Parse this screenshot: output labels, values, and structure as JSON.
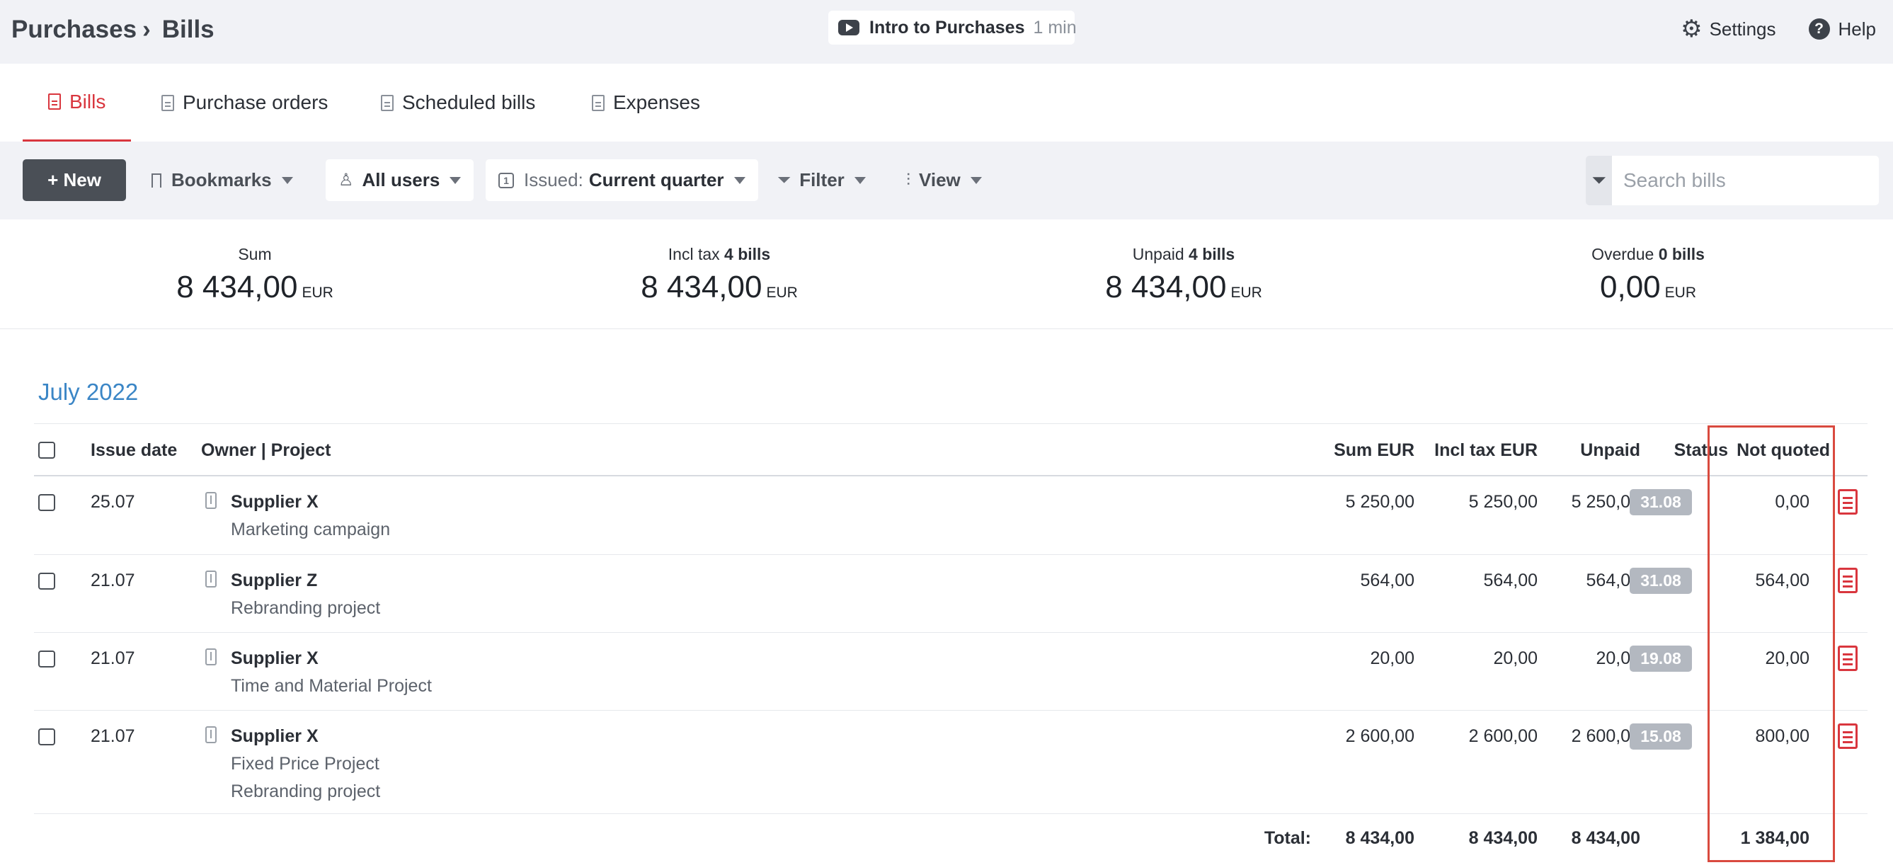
{
  "header": {
    "breadcrumb_parent": "Purchases",
    "breadcrumb_sep": "›",
    "breadcrumb_current": "Bills",
    "intro_label": "Intro to Purchases",
    "intro_duration": "1 min",
    "settings_label": "Settings",
    "help_label": "Help"
  },
  "tabs": [
    {
      "label": "Bills",
      "active": true
    },
    {
      "label": "Purchase orders",
      "active": false
    },
    {
      "label": "Scheduled bills",
      "active": false
    },
    {
      "label": "Expenses",
      "active": false
    }
  ],
  "toolbar": {
    "new_label": "+ New",
    "bookmarks_label": "Bookmarks",
    "users_label": "All users",
    "issued_prefix": "Issued:",
    "issued_value": "Current quarter",
    "calendar_number": "1",
    "filter_label": "Filter",
    "view_label": "View",
    "search_placeholder": "Search bills"
  },
  "summary": [
    {
      "label": "Sum",
      "bold": "",
      "value": "8 434,00",
      "currency": "EUR"
    },
    {
      "label": "Incl tax",
      "bold": "4 bills",
      "value": "8 434,00",
      "currency": "EUR"
    },
    {
      "label": "Unpaid",
      "bold": "4 bills",
      "value": "8 434,00",
      "currency": "EUR"
    },
    {
      "label": "Overdue",
      "bold": "0 bills",
      "value": "0,00",
      "currency": "EUR"
    }
  ],
  "month": "July 2022",
  "table": {
    "headers": {
      "issue_date": "Issue date",
      "owner_project": "Owner | Project",
      "sum": "Sum EUR",
      "incl_tax": "Incl tax EUR",
      "unpaid": "Unpaid",
      "status": "Status",
      "not_quoted": "Not quoted"
    },
    "rows": [
      {
        "date": "25.07",
        "supplier": "Supplier X",
        "projects": [
          "Marketing campaign"
        ],
        "sum": "5 250,00",
        "incl_tax": "5 250,00",
        "unpaid": "5 250,00",
        "status": "31.08",
        "not_quoted": "0,00"
      },
      {
        "date": "21.07",
        "supplier": "Supplier Z",
        "projects": [
          "Rebranding project"
        ],
        "sum": "564,00",
        "incl_tax": "564,00",
        "unpaid": "564,00",
        "status": "31.08",
        "not_quoted": "564,00"
      },
      {
        "date": "21.07",
        "supplier": "Supplier X",
        "projects": [
          "Time and Material Project"
        ],
        "sum": "20,00",
        "incl_tax": "20,00",
        "unpaid": "20,00",
        "status": "19.08",
        "not_quoted": "20,00"
      },
      {
        "date": "21.07",
        "supplier": "Supplier X",
        "projects": [
          "Fixed Price Project",
          "Rebranding project"
        ],
        "sum": "2 600,00",
        "incl_tax": "2 600,00",
        "unpaid": "2 600,00",
        "status": "15.08",
        "not_quoted": "800,00"
      }
    ],
    "total": {
      "label": "Total:",
      "sum": "8 434,00",
      "incl_tax": "8 434,00",
      "unpaid": "8 434,00",
      "not_quoted": "1 384,00"
    }
  }
}
